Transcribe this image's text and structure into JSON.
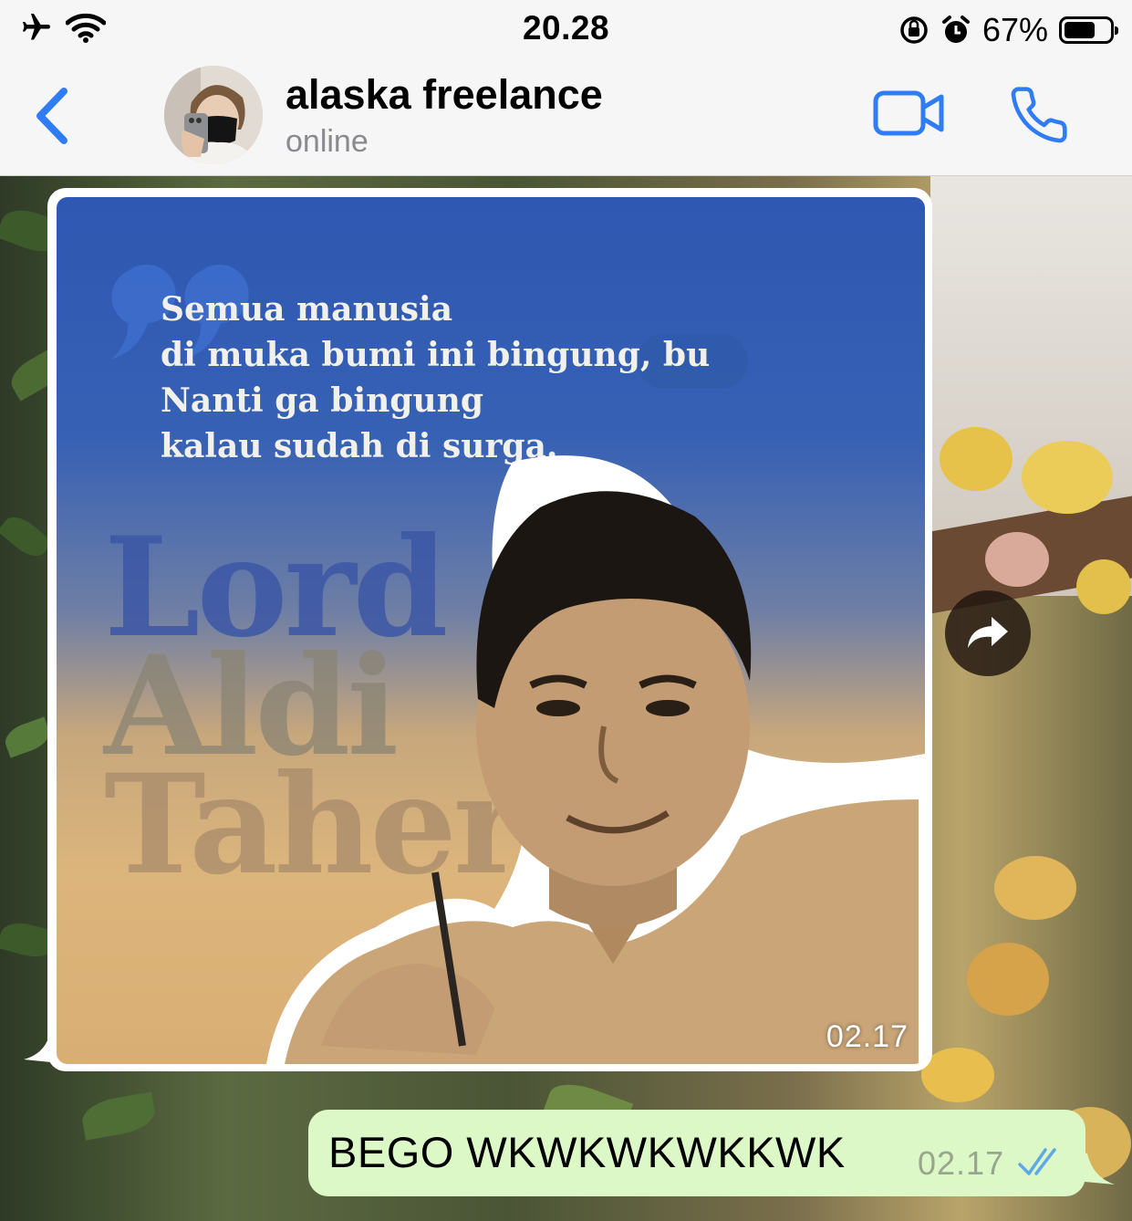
{
  "status_bar": {
    "time": "20.28",
    "battery_text": "67%",
    "battery_level": 0.67,
    "icons": [
      "airplane-icon",
      "wifi-icon",
      "rotation-lock-icon",
      "alarm-icon",
      "battery-icon"
    ]
  },
  "header": {
    "contact_name": "alaska freelance",
    "status": "online",
    "accent_color": "#2f7cf6"
  },
  "messages": [
    {
      "direction": "incoming",
      "type": "image",
      "time": "02.17",
      "poster": {
        "quote_lines": [
          "Semua manusia",
          "di muka bumi ini bingung, bu",
          "Nanti ga bingung",
          "kalau sudah di surga."
        ],
        "name_lines": [
          "Lord",
          "Aldi",
          "Taher"
        ]
      }
    },
    {
      "direction": "outgoing",
      "type": "text",
      "text": "BEGO WKWKWKWKKWK",
      "time": "02.17",
      "status": "read"
    }
  ]
}
